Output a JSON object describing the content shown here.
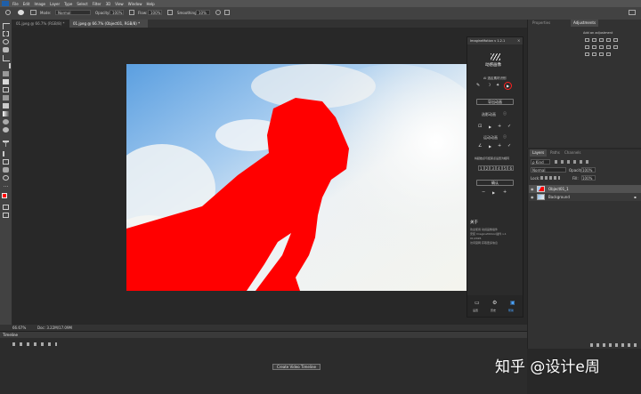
{
  "menu": [
    "File",
    "Edit",
    "Image",
    "Layer",
    "Type",
    "Select",
    "Filter",
    "3D",
    "View",
    "Window",
    "Help"
  ],
  "options": {
    "mode_label": "Mode:",
    "mode_value": "Normal",
    "opacity_label": "Opacity:",
    "opacity_value": "100%",
    "flow_label": "Flow:",
    "flow_value": "100%",
    "smoothing_label": "Smoothing:",
    "smoothing_value": "10%"
  },
  "tabs": [
    "01.jpeg @ 66.7% (RGB/8) *",
    "01.jpeg @ 66.7% (Object01, RGB/8) *"
  ],
  "plugin": {
    "title": "ImagineMotion v 1.2.1",
    "brand": "动感画像",
    "subtitle": "AI 选区素材识别",
    "primary_button": "导出动画",
    "section1": "选影动画",
    "section2": "运动动画",
    "section3": "将起始点与结束点设置为相同",
    "numbers": [
      "1",
      "2",
      "3",
      "4",
      "5",
      "6"
    ],
    "mid_button": "确认",
    "about_title": "关于",
    "about_text_1": "欢迎使用 动感画像插件",
    "about_text_2": "安装 ImagineMotion插件 v.1",
    "about_text_3": "01/2026",
    "about_text_4": "访问官网 获取更多信息",
    "bottom_tabs": [
      "设置",
      "历史",
      "帮助"
    ]
  },
  "props": {
    "tabs": [
      "Properties",
      "Adjustments"
    ],
    "add_label": "Add an adjustment"
  },
  "layers": {
    "tabs": [
      "Layers",
      "Paths",
      "Channels"
    ],
    "kind_label": "ρ Kind",
    "blend": "Normal",
    "opacity_label": "Opacity:",
    "opacity_value": "100%",
    "lock_label": "Lock:",
    "fill_label": "Fill:",
    "fill_value": "100%",
    "rows": [
      {
        "name": "Object01_1"
      },
      {
        "name": "Background"
      }
    ]
  },
  "status": {
    "zoom": "66.67%",
    "doc": "Doc: 3.22M/17.09M"
  },
  "timeline": {
    "title": "Timeline",
    "create_button": "Create Video Timeline"
  },
  "watermark": "知乎 @设计e周"
}
